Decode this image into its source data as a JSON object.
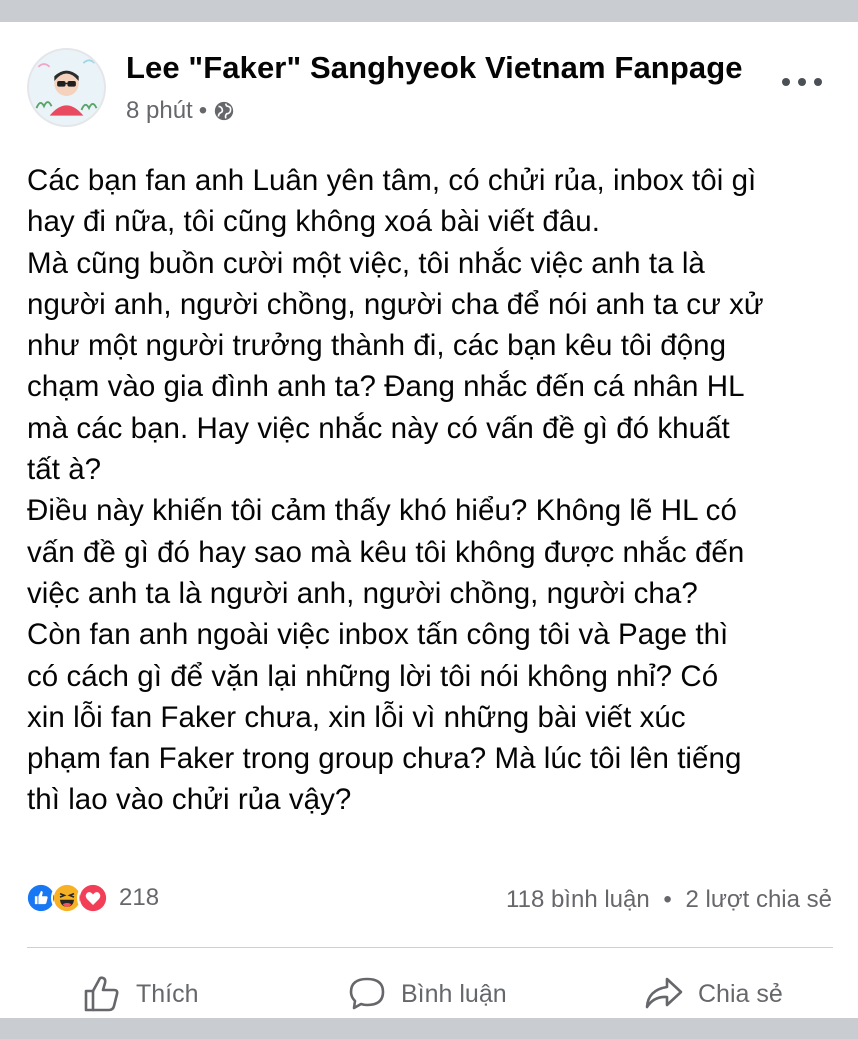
{
  "post": {
    "author": "Lee \"Faker\"  Sanghyeok Vietnam Fanpage",
    "time": "8 phút",
    "separator": "•",
    "audience_icon": "globe-icon",
    "more_icon": "more-options-icon",
    "lines": [
      "Các bạn fan anh Luân yên tâm, có chửi rủa, inbox tôi gì",
      "hay đi nữa, tôi cũng không xoá bài viết đâu.",
      "Mà cũng buồn cười một việc, tôi nhắc việc anh ta là",
      "người anh, người chồng, người cha để nói anh ta cư xử",
      "như một người trưởng thành đi, các bạn kêu tôi động",
      "chạm vào gia đình anh ta? Đang nhắc đến cá nhân HL",
      "mà các bạn. Hay việc nhắc này có vấn đề gì đó khuất",
      "tất à?",
      "Điều này khiến tôi cảm thấy khó hiểu? Không lẽ HL có",
      "vấn đề gì đó hay sao mà kêu tôi không được nhắc đến",
      "việc anh ta là người anh, người chồng, người cha?",
      "Còn fan anh ngoài việc inbox tấn công tôi và Page thì",
      "có cách gì để vặn lại những lời tôi nói không nhỉ?  Có",
      "xin lỗi fan Faker chưa, xin lỗi vì những bài viết xúc",
      "phạm fan Faker trong group chưa? Mà lúc tôi lên tiếng",
      "thì lao vào chửi rủa vậy?"
    ]
  },
  "engagement": {
    "reaction_icons": [
      "like-reaction-icon",
      "haha-reaction-icon",
      "love-reaction-icon"
    ],
    "reaction_count": "218",
    "comments": "118 bình luận",
    "separator": "•",
    "shares": "2 lượt chia sẻ"
  },
  "actions": {
    "like_label": "Thích",
    "comment_label": "Bình luận",
    "share_label": "Chia sẻ"
  },
  "colors": {
    "text": "#050505",
    "secondary": "#65676b",
    "like_blue": "#1877f2",
    "love_red": "#f33e58",
    "haha_yellow": "#f7b125",
    "background": "#c9ccd1"
  }
}
